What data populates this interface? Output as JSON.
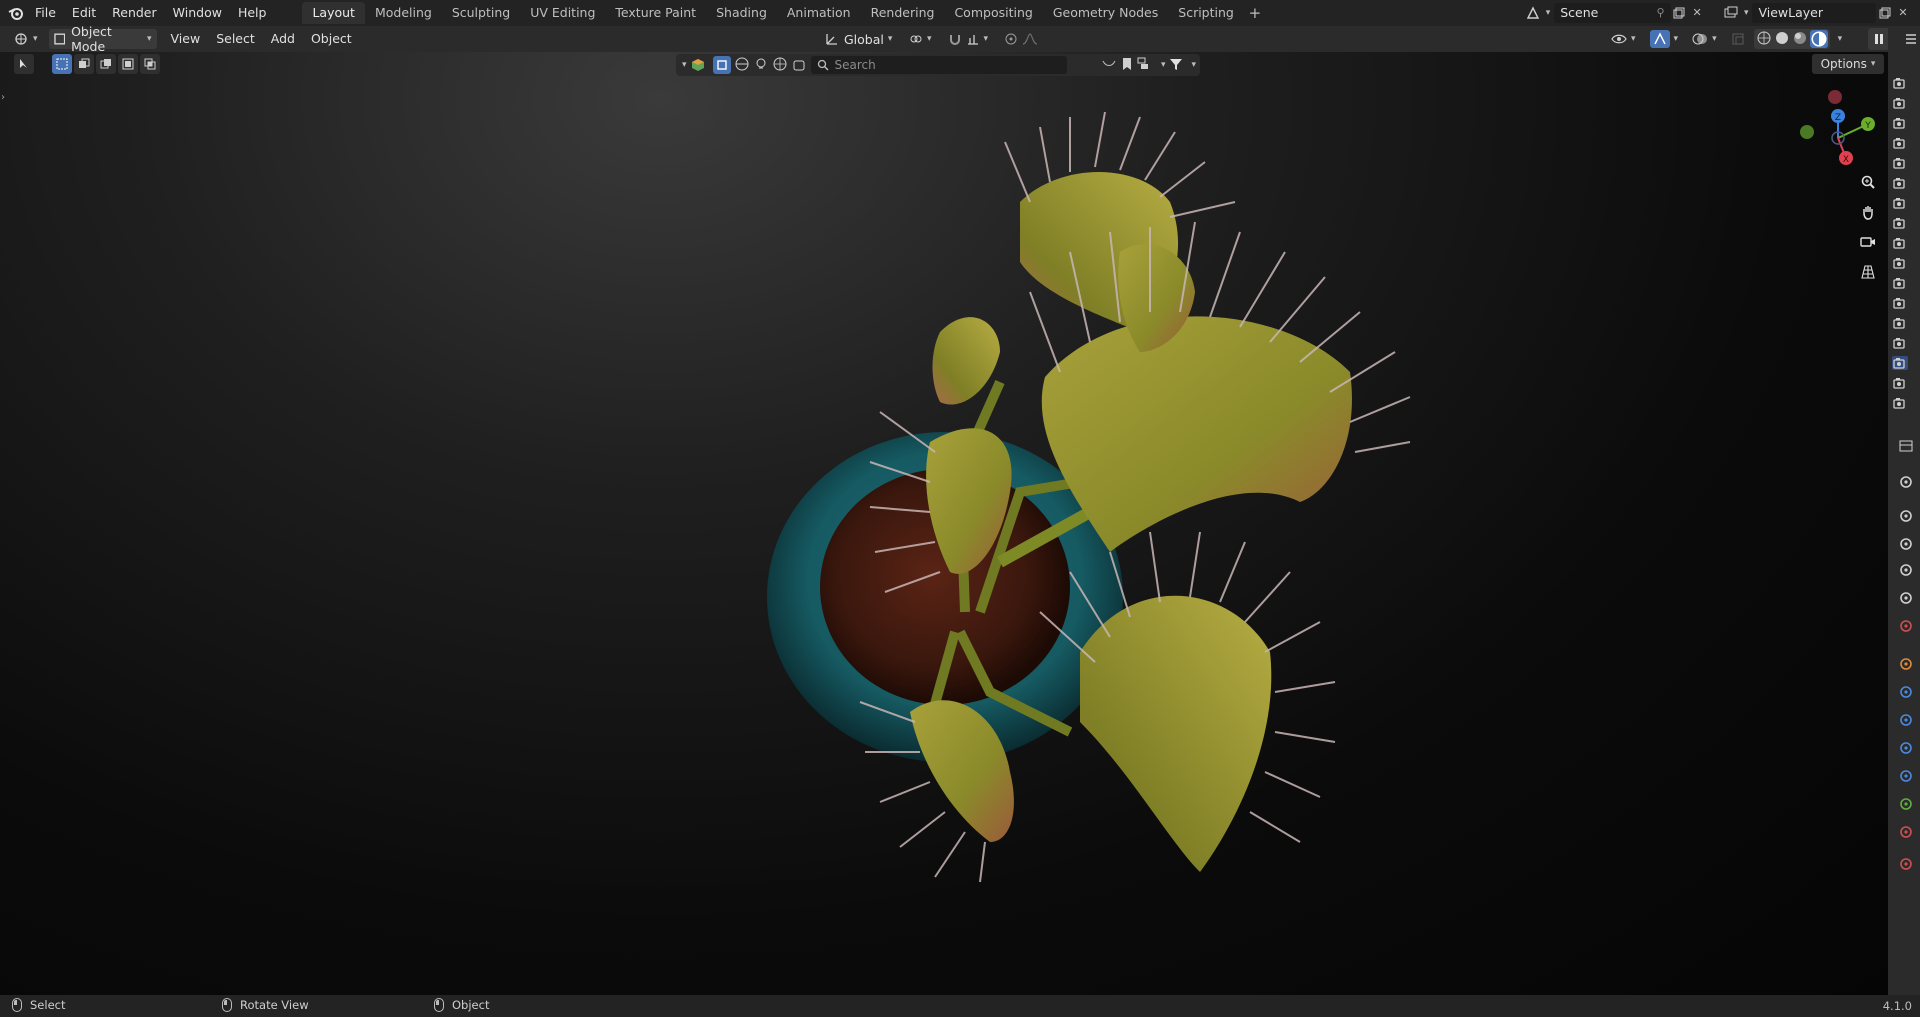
{
  "topbar": {
    "menus": [
      "File",
      "Edit",
      "Render",
      "Window",
      "Help"
    ],
    "workspaces": [
      "Layout",
      "Modeling",
      "Sculpting",
      "UV Editing",
      "Texture Paint",
      "Shading",
      "Animation",
      "Rendering",
      "Compositing",
      "Geometry Nodes",
      "Scripting"
    ],
    "active_workspace": "Layout",
    "add_workspace": "+",
    "scene": "Scene",
    "view_layer": "ViewLayer"
  },
  "viewport_header": {
    "mode": "Object Mode",
    "menus": [
      "View",
      "Select",
      "Add",
      "Object"
    ],
    "orientation": "Global"
  },
  "filter": {
    "search_placeholder": "Search"
  },
  "options_label": "Options",
  "statusbar": {
    "select": "Select",
    "rotate": "Rotate View",
    "object": "Object",
    "version": "4.1.0"
  },
  "gizmo": {
    "x": "X",
    "y": "Y",
    "z": "Z"
  },
  "colors": {
    "accent": "#4772b3",
    "x_axis": "#e0404f",
    "y_axis": "#6aae2c",
    "z_axis": "#3a82e0"
  }
}
